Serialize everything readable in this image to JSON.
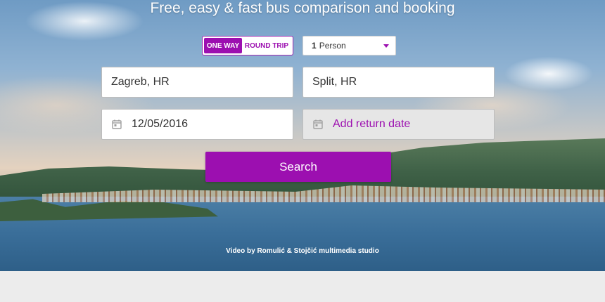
{
  "hero": {
    "headline": "Free, easy & fast bus comparison and booking",
    "credit": "Video by Romulić & Stojčić multimedia studio"
  },
  "trip_type": {
    "one_way_label": "ONE WAY",
    "round_trip_label": "ROUND TRIP",
    "selected": "ONE WAY"
  },
  "passengers": {
    "count": "1",
    "unit": "Person"
  },
  "route": {
    "from_value": "Zagreb, HR",
    "to_value": "Split, HR"
  },
  "dates": {
    "departure_value": "12/05/2016",
    "return_label": "Add return date"
  },
  "search": {
    "button_label": "Search"
  },
  "colors": {
    "accent": "#9c0fb0",
    "field_bg": "#ffffff",
    "return_bg": "#e6e6e6",
    "footer_bg": "#ececec"
  }
}
